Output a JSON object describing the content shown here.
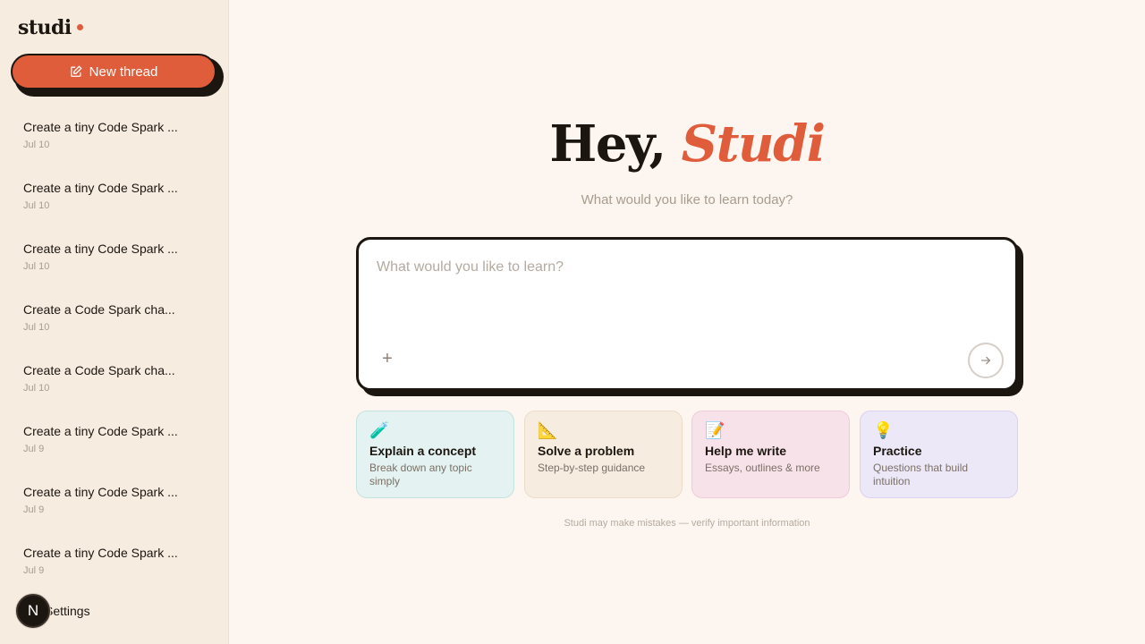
{
  "app": {
    "logo": "studi"
  },
  "sidebar": {
    "new_thread_label": "New thread",
    "threads": [
      {
        "title": "Create a tiny Code Spark ...",
        "date": "Jul 10"
      },
      {
        "title": "Create a tiny Code Spark ...",
        "date": "Jul 10"
      },
      {
        "title": "Create a tiny Code Spark ...",
        "date": "Jul 10"
      },
      {
        "title": "Create a Code Spark cha...",
        "date": "Jul 10"
      },
      {
        "title": "Create a Code Spark cha...",
        "date": "Jul 10"
      },
      {
        "title": "Create a tiny Code Spark ...",
        "date": "Jul 9"
      },
      {
        "title": "Create a tiny Code Spark ...",
        "date": "Jul 9"
      },
      {
        "title": "Create a tiny Code Spark ...",
        "date": "Jul 9"
      }
    ],
    "avatar_letter": "N",
    "settings_label": "Settings"
  },
  "main": {
    "greeting_prefix": "Hey,",
    "greeting_name": "Studi",
    "subtitle": "What would you like to learn today?",
    "composer": {
      "placeholder": "What would you like to learn?",
      "value": ""
    },
    "cards": [
      {
        "emoji": "🧪",
        "title": "Explain a concept",
        "desc": "Break down any topic simply"
      },
      {
        "emoji": "📐",
        "title": "Solve a problem",
        "desc": "Step-by-step guidance"
      },
      {
        "emoji": "📝",
        "title": "Help me write",
        "desc": "Essays, outlines & more"
      },
      {
        "emoji": "💡",
        "title": "Practice",
        "desc": "Questions that build intuition"
      }
    ],
    "disclaimer": "Studi may make mistakes — verify important information"
  },
  "colors": {
    "accent": "#e05d3c",
    "ink": "#1c1611",
    "sidebar_bg": "#f6ece0",
    "page_bg": "#fdf6f0"
  },
  "icons": {
    "new_thread": "edit-icon",
    "add": "plus-icon",
    "send": "arrow-right-icon"
  }
}
